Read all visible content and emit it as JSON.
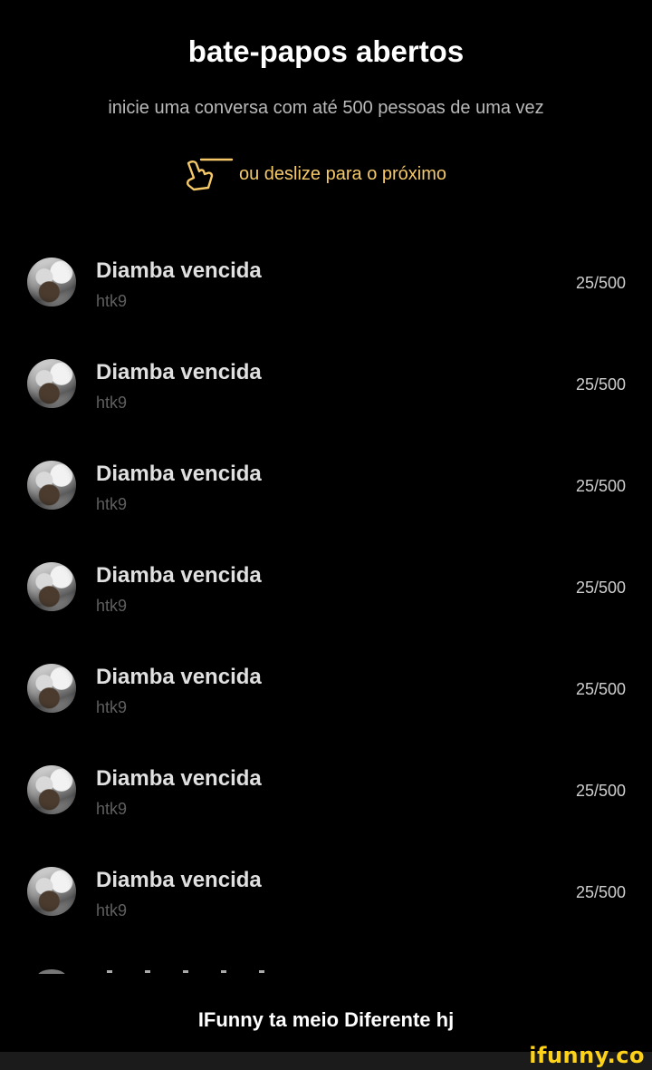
{
  "header": {
    "title": "bate-papos abertos",
    "subtitle": "inicie uma conversa com até 500 pessoas de uma vez",
    "swipe_hint": "ou deslize para o próximo",
    "swipe_icon": "swipe-hand-icon",
    "accent_color": "#f5c968"
  },
  "chats": [
    {
      "name": "Diamba vencida",
      "handle": "htk9",
      "count": "25/500"
    },
    {
      "name": "Diamba vencida",
      "handle": "htk9",
      "count": "25/500"
    },
    {
      "name": "Diamba vencida",
      "handle": "htk9",
      "count": "25/500"
    },
    {
      "name": "Diamba vencida",
      "handle": "htk9",
      "count": "25/500"
    },
    {
      "name": "Diamba vencida",
      "handle": "htk9",
      "count": "25/500"
    },
    {
      "name": "Diamba vencida",
      "handle": "htk9",
      "count": "25/500"
    },
    {
      "name": "Diamba vencida",
      "handle": "htk9",
      "count": "25/500"
    }
  ],
  "caption": "IFunny ta meio Diferente hj",
  "watermark": "ifunny.co"
}
